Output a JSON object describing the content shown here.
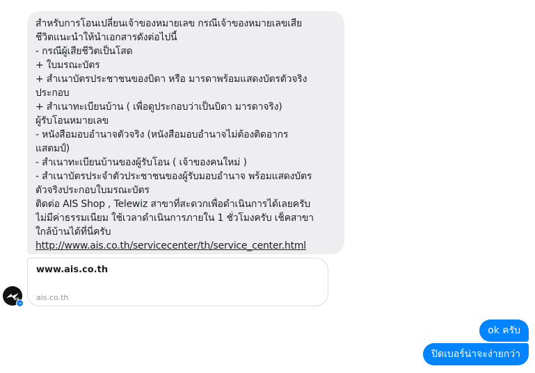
{
  "conversation": {
    "incoming_message": {
      "lines": [
        "สำหรับการโอนเปลี่ยนเจ้าของหมายเลข กรณีเจ้าของหมายเลขเสีย",
        "ชีวิตแนะนำให้นำเอกสารดังต่อไปนี้",
        "- กรณีผู้เสียชีวิตเป็นโสด",
        "+ ใบมรณะบัตร",
        "+ สำเนาบัตรประชาชนของบิดา หรือ มารดาพร้อมแสดงบัตรตัวจริง",
        "ประกอบ",
        "+ สำเนาทะเบียนบ้าน ( เพื่อดูประกอบว่าเป็นบิดา มารดาจริง)",
        "ผู้รับโอนหมายเลข",
        "- หนังสือมอบอำนาจตัวจริง (หนังสือมอบอำนาจไม่ต้องติดอากร",
        "แสตมป์)",
        "- สำเนาทะเบียนบ้านของผู้รับโอน ( เจ้าของคนใหม่ )",
        "- สำเนาบัตรประจำตัวประชาชนของผู้รับมอบอำนาจ พร้อมแสดงบัตร",
        "ตัวจริงประกอบใบมรณะบัตร",
        "ติดต่อ AIS Shop , Telewiz สาขาที่สะดวกเพื่อดำเนินการได้เลยครับ",
        "ไม่มีค่าธรรมเนียม ใช้เวลาดำเนินการภายใน 1 ชั่วโมงครับ เช็คสาขา",
        "ใกล้บ้านได้ที่นี่ครับ"
      ],
      "link_text": "http://www.ais.co.th/servicecenter/th/service_center.html"
    },
    "link_preview": {
      "title": "www.ais.co.th",
      "domain": "ais.co.th"
    },
    "sender_avatar": {
      "label": "AIS",
      "icon": "ais-logo-icon",
      "badge_icon": "messenger-badge-icon"
    },
    "outgoing_messages": [
      {
        "text": "ok ครับ"
      },
      {
        "text": "ปิดเบอร์น่าจะง่ายกว่า"
      }
    ],
    "colors": {
      "incoming_bubble": "#eeeef0",
      "outgoing_bubble": "#0084ff"
    }
  }
}
